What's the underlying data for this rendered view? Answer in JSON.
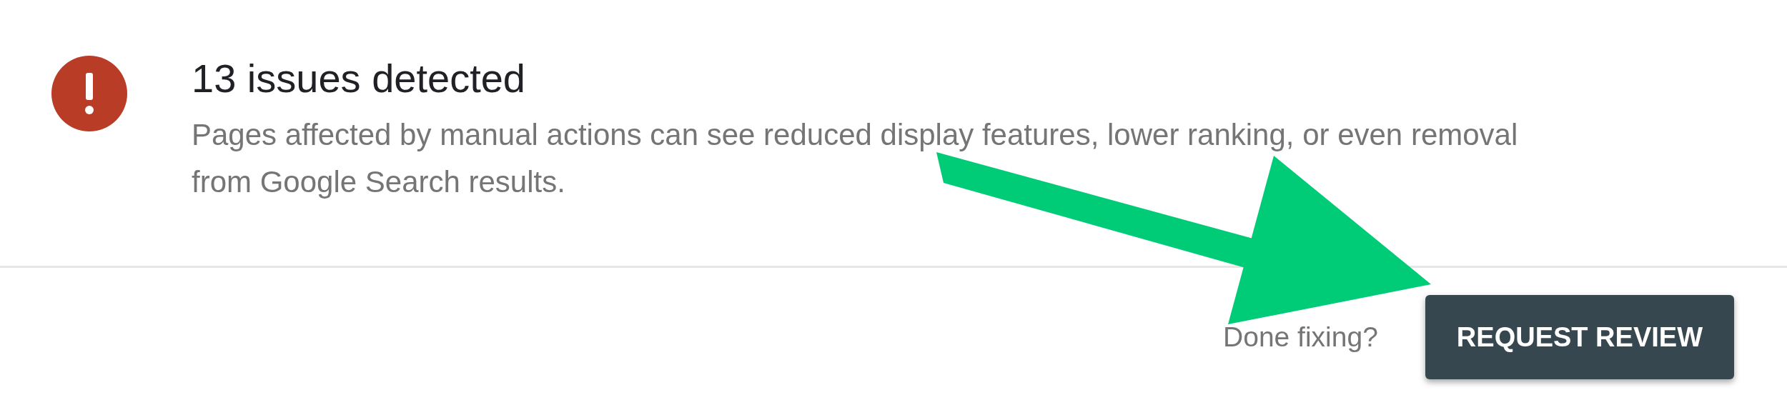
{
  "alert": {
    "title": "13 issues detected",
    "description": "Pages affected by manual actions can see reduced display features, lower ranking, or even removal from Google Search results."
  },
  "footer": {
    "prompt": "Done fixing?",
    "button": "REQUEST REVIEW"
  }
}
